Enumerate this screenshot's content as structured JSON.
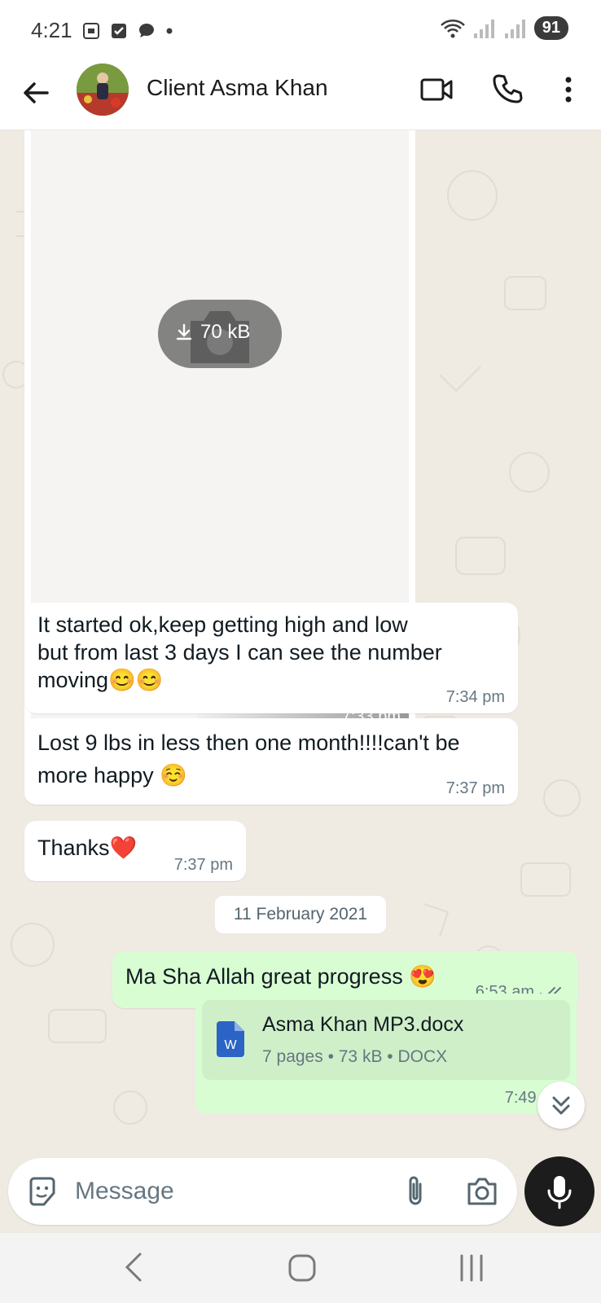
{
  "status_bar": {
    "time": "4:21",
    "battery": "91"
  },
  "header": {
    "contact_name": "Client Asma Khan"
  },
  "image_message": {
    "download_size": "70 kB",
    "time": "7:33 pm"
  },
  "messages": [
    {
      "direction": "in",
      "text": "It started ok,keep getting high and low\nbut from last 3 days I can see the number\nmoving😊😊",
      "time": "7:34 pm"
    },
    {
      "direction": "in",
      "text": "Lost 9 lbs in less then one month!!!!can't be\nmore happy ☺️",
      "time": "7:37 pm"
    },
    {
      "direction": "in",
      "text": "Thanks❤️",
      "time": "7:37 pm"
    },
    {
      "direction": "out",
      "text": "Ma Sha Allah great progress 😍",
      "time": "6:53 am"
    }
  ],
  "date_separator": "11 February 2021",
  "document_message": {
    "file_name": "Asma Khan MP3.docx",
    "meta": "7 pages • 73 kB • DOCX",
    "icon_letter": "W",
    "time": "7:49 am"
  },
  "composer": {
    "placeholder": "Message"
  },
  "colors": {
    "chat_bg": "#efeae2",
    "incoming_bubble": "#ffffff",
    "outgoing_bubble": "#d9fdd3",
    "doc_icon": "#2b64c5",
    "mic_button": "#1c1c1c"
  }
}
